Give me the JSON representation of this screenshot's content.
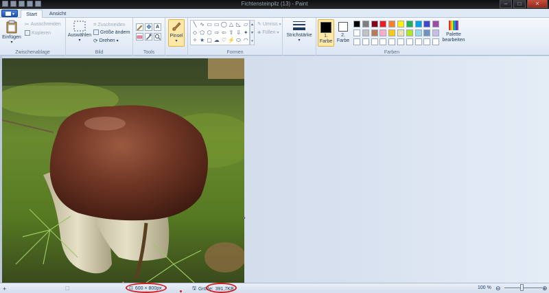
{
  "window": {
    "title": "Fichtensteinpilz (13) - Paint",
    "minimize_glyph": "–",
    "maximize_glyph": "□",
    "close_glyph": "✕"
  },
  "tabs": [
    {
      "label": "Start",
      "active": true
    },
    {
      "label": "Ansicht",
      "active": false
    }
  ],
  "ribbon": {
    "zwischenablage": {
      "label": "Zwischenablage",
      "paste": "Einfügen",
      "cut": "Ausschneiden",
      "copy": "Kopieren"
    },
    "bild": {
      "label": "Bild",
      "select": "Auswählen",
      "crop": "Zuschneiden",
      "resize": "Größe ändern",
      "rotate": "Drehen"
    },
    "tools": {
      "label": "Tools",
      "text_tool_glyph": "A"
    },
    "brushes": {
      "label": "Pinsel"
    },
    "formen": {
      "label": "Formen",
      "outline": "Umriss",
      "fill": "Füllen",
      "shapes": [
        "╲",
        "∿",
        "▭",
        "▭",
        "◯",
        "△",
        "◺",
        "▱",
        "◇",
        "⬠",
        "⬡",
        "⇨",
        "⇦",
        "⇧",
        "⇩",
        "✦",
        "✧",
        "★",
        "▢",
        "☁",
        "♡",
        "⚡",
        "⬭",
        "◠"
      ]
    },
    "strichstaerke": {
      "label": "Strichstärke"
    },
    "farben": {
      "label": "Farben",
      "color1_label": "1. Farbe",
      "color2_label": "2. Farbe",
      "color1": "#000000",
      "color2": "#ffffff",
      "edit_palette": "Palette bearbeiten",
      "palette_row1": [
        "#000000",
        "#7f7f7f",
        "#880015",
        "#ed1c24",
        "#ff7f27",
        "#fff200",
        "#22b14c",
        "#00a2e8",
        "#3f48cc",
        "#a349a4"
      ],
      "palette_row2": [
        "#ffffff",
        "#c3c3c3",
        "#b97a57",
        "#ffaec9",
        "#ffc90e",
        "#efe4b0",
        "#b5e61d",
        "#99d9ea",
        "#7092be",
        "#c8bfe7"
      ],
      "palette_row3": [
        "#ffffff",
        "#ffffff",
        "#ffffff",
        "#ffffff",
        "#ffffff",
        "#ffffff",
        "#ffffff",
        "#ffffff",
        "#ffffff",
        "#ffffff"
      ]
    }
  },
  "statusbar": {
    "dimensions": "600 × 800px",
    "size_label": "Größe:",
    "size_value": "391,7KB",
    "zoom": "100 %",
    "zoom_out_glyph": "⊖",
    "zoom_in_glyph": "⊕"
  },
  "colors": {
    "annotation_red": "#d51b1b",
    "brush_selected": "#fde8a8"
  }
}
